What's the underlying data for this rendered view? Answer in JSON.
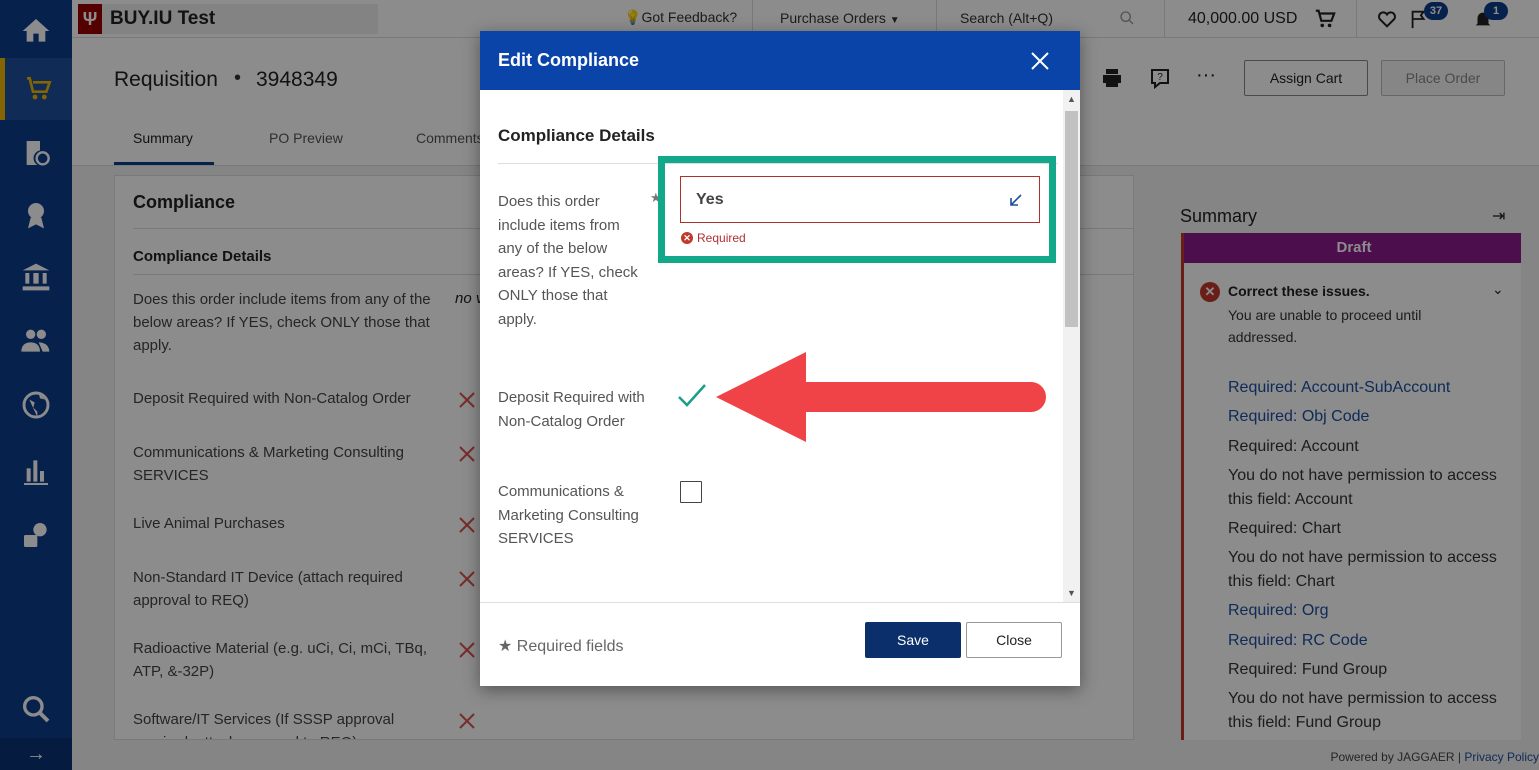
{
  "topbar": {
    "logo_mark": "Ψ",
    "logo_text": "BUY.IU Test",
    "feedback": "Got Feedback?",
    "purchase_orders": "Purchase Orders",
    "search_placeholder": "Search (Alt+Q)",
    "cart_total": "40,000.00 USD",
    "flag_count": "37",
    "notification_count": "1"
  },
  "requisition": {
    "title": "Requisition",
    "separator": "•",
    "number": "3948349",
    "assign_cart": "Assign Cart",
    "place_order": "Place Order"
  },
  "tabs": [
    {
      "label": "Summary",
      "active": true
    },
    {
      "label": "PO Preview",
      "active": false
    },
    {
      "label": "Comments",
      "active": false
    }
  ],
  "panel": {
    "title": "Compliance",
    "subtitle": "Compliance Details",
    "question": "Does this order include items from any of the below areas? If YES, check ONLY those that apply.",
    "current_value": "no v",
    "rows": [
      "Deposit Required with Non-Catalog Order",
      "Communications & Marketing Consulting SERVICES",
      "Live Animal Purchases",
      "Non-Standard IT Device (attach required approval to REQ)",
      "Radioactive Material (e.g. uCi, Ci, mCi, TBq, ATP, &-32P)",
      "Software/IT Services (If SSSP approval required, attach approval to REQ)"
    ]
  },
  "summary": {
    "title": "Summary",
    "status": "Draft",
    "issue_title": "Correct these issues.",
    "issue_sub": "You are unable to proceed until addressed.",
    "issues": [
      {
        "text": "Required: Account-SubAccount",
        "link": true
      },
      {
        "text": "Required: Obj Code",
        "link": true
      },
      {
        "text": "Required: Account",
        "link": false
      },
      {
        "text": "You do not have permission to access this field: Account",
        "link": false
      },
      {
        "text": "Required: Chart",
        "link": false
      },
      {
        "text": "You do not have permission to access this field: Chart",
        "link": false
      },
      {
        "text": "Required: Org",
        "link": true
      },
      {
        "text": "Required: RC Code",
        "link": true
      },
      {
        "text": "Required: Fund Group",
        "link": false
      },
      {
        "text": "You do not have permission to access this field: Fund Group",
        "link": false
      }
    ]
  },
  "footer": {
    "powered_by": "Powered by JAGGAER |",
    "privacy": "Privacy Policy"
  },
  "modal": {
    "title": "Edit Compliance",
    "section_title": "Compliance Details",
    "question": "Does this order include items from any of the below areas? If YES, check ONLY those that apply.",
    "required_star": "★",
    "select_value": "Yes",
    "required_msg": "Required",
    "options": [
      {
        "label": "Deposit Required with Non-Catalog Order",
        "checked": true
      },
      {
        "label": "Communications & Marketing Consulting SERVICES",
        "checked": false
      }
    ],
    "required_fields": "Required fields",
    "save": "Save",
    "close": "Close"
  },
  "colors": {
    "nav": "#0d3c8c",
    "modal_header": "#0b44a8",
    "highlight": "#13a88a",
    "arrow": "#f04347",
    "error": "#b03030",
    "draft": "#8b1a8b"
  }
}
